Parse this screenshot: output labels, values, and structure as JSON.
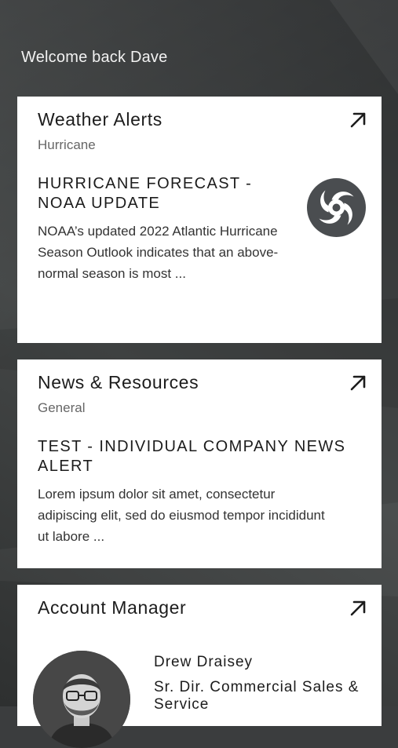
{
  "greeting": "Welcome back Dave",
  "cards": {
    "weather": {
      "title": "Weather Alerts",
      "category": "Hurricane",
      "headline": "HURRICANE FORECAST - NOAA UPDATE",
      "summary": "NOAA’s updated 2022 Atlantic Hurricane Season Outlook indicates that an above-normal season is most ...",
      "icon": "hurricane-icon",
      "open_icon": "arrow-up-right-icon"
    },
    "news": {
      "title": "News & Resources",
      "category": "General",
      "headline": "TEST - INDIVIDUAL COMPANY NEWS ALERT",
      "summary": "Lorem ipsum dolor sit amet, consectetur adipiscing elit, sed do eiusmod tempor incididunt ut labore ...",
      "open_icon": "arrow-up-right-icon"
    },
    "account_manager": {
      "title": "Account Manager",
      "name": "Drew Draisey",
      "role": "Sr. Dir. Commercial Sales & Service",
      "open_icon": "arrow-up-right-icon"
    }
  },
  "colors": {
    "background": "#3b3d3e",
    "card": "#ffffff",
    "icon_badge": "#4a4d50",
    "text_dark": "#1c1c1c",
    "text_muted": "#666666"
  }
}
